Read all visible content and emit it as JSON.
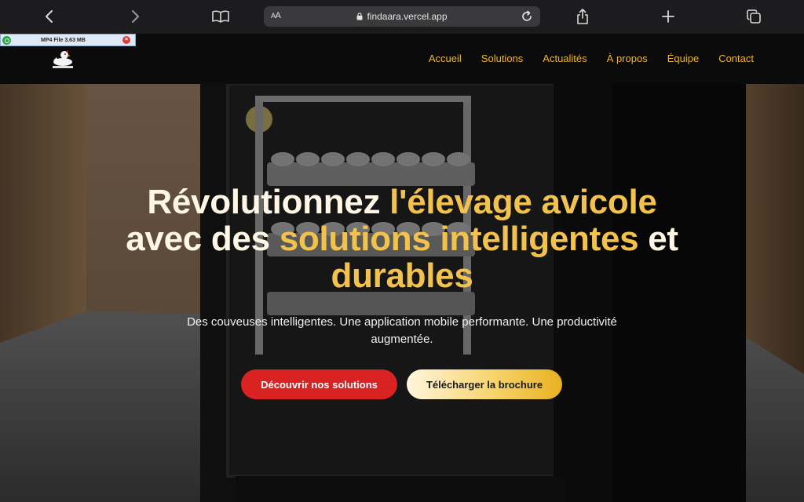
{
  "browser": {
    "url_aa": "AA",
    "url": "findaara.vercel.app"
  },
  "download": {
    "label": "MP4 File 3.63 MB"
  },
  "nav": {
    "links": [
      "Accueil",
      "Solutions",
      "Actualités",
      "À propos",
      "Équipe",
      "Contact"
    ]
  },
  "hero": {
    "headline_parts": [
      "Révolutionnez ",
      "l'élevage avicole",
      "avec des ",
      "solutions intelligentes",
      " et ",
      "durables"
    ],
    "subtitle": "Des couveuses intelligentes. Une application mobile performante. Une productivité augmentée.",
    "primary_button": "Découvrir nos solutions",
    "secondary_button": "Télécharger la brochure"
  },
  "colors": {
    "accent": "#f1b52a",
    "primary_button": "#d92323",
    "nav_bg": "#0b0b0b",
    "browser_bar": "#1c1c1e"
  },
  "icons": [
    "back-icon",
    "forward-icon",
    "reader-icon",
    "lock-icon",
    "reload-icon",
    "share-icon",
    "new-tab-icon",
    "tabs-icon",
    "logo-icon"
  ]
}
